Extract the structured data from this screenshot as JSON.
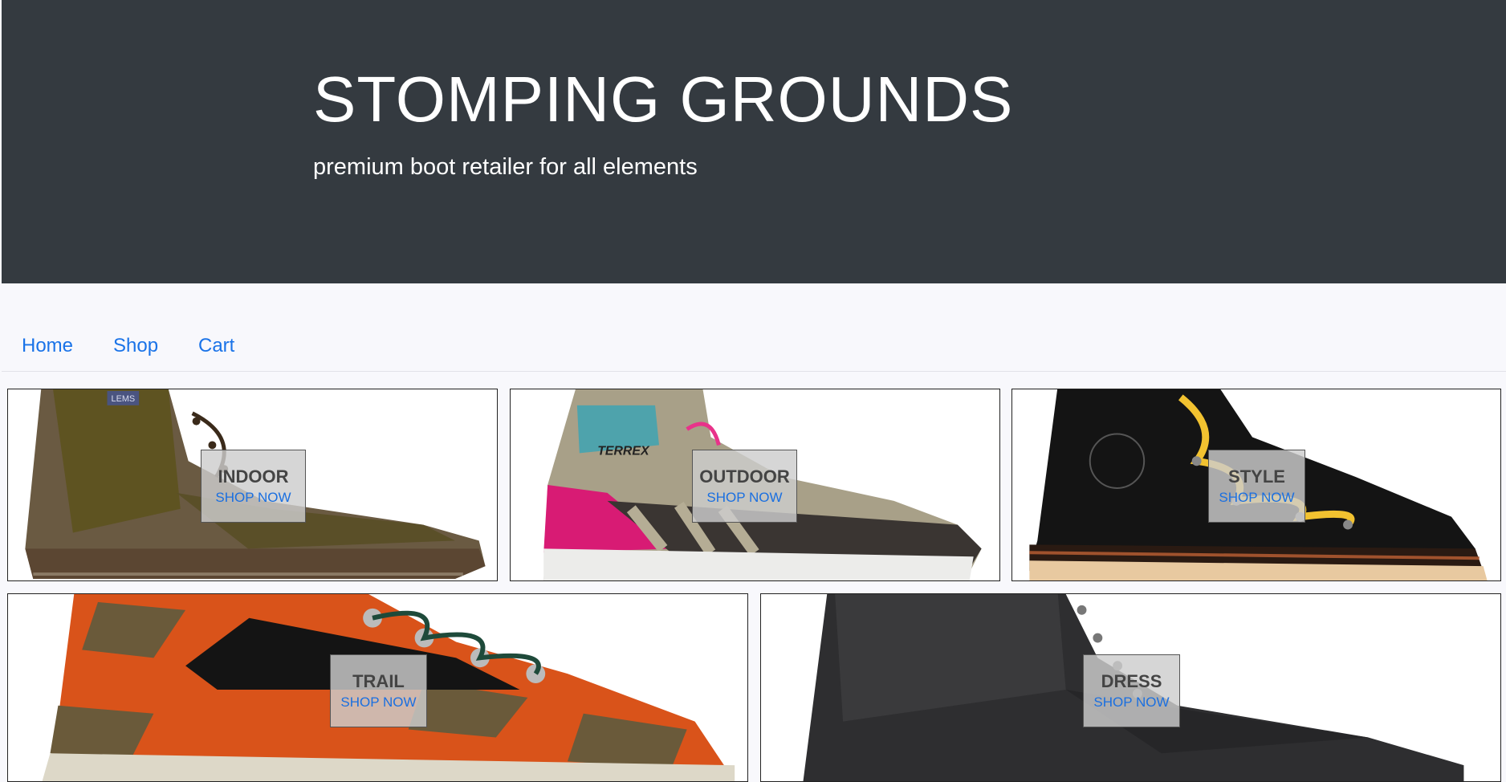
{
  "header": {
    "title": "STOMPING GROUNDS",
    "tagline": "premium boot retailer for all elements"
  },
  "nav": {
    "items": [
      {
        "label": "Home"
      },
      {
        "label": "Shop"
      },
      {
        "label": "Cart"
      }
    ]
  },
  "categories": [
    {
      "title": "INDOOR",
      "cta": "SHOP NOW",
      "image": "brown-canvas-moc-boot"
    },
    {
      "title": "OUTDOOR",
      "cta": "SHOP NOW",
      "image": "terrex-hiking-sneaker"
    },
    {
      "title": "STYLE",
      "cta": "SHOP NOW",
      "image": "black-leather-yellow-lace-boot"
    },
    {
      "title": "TRAIL",
      "cta": "SHOP NOW",
      "image": "orange-camo-hiking-boot"
    },
    {
      "title": "DRESS",
      "cta": "SHOP NOW",
      "image": "black-leather-dress-boot"
    }
  ],
  "image_logos": {
    "indoor_tag": "LEMS",
    "outdoor_brand": "TERREX"
  },
  "colors": {
    "hero_bg": "#343a40",
    "link": "#1a73e8",
    "page_bg": "#f8f8fc"
  }
}
